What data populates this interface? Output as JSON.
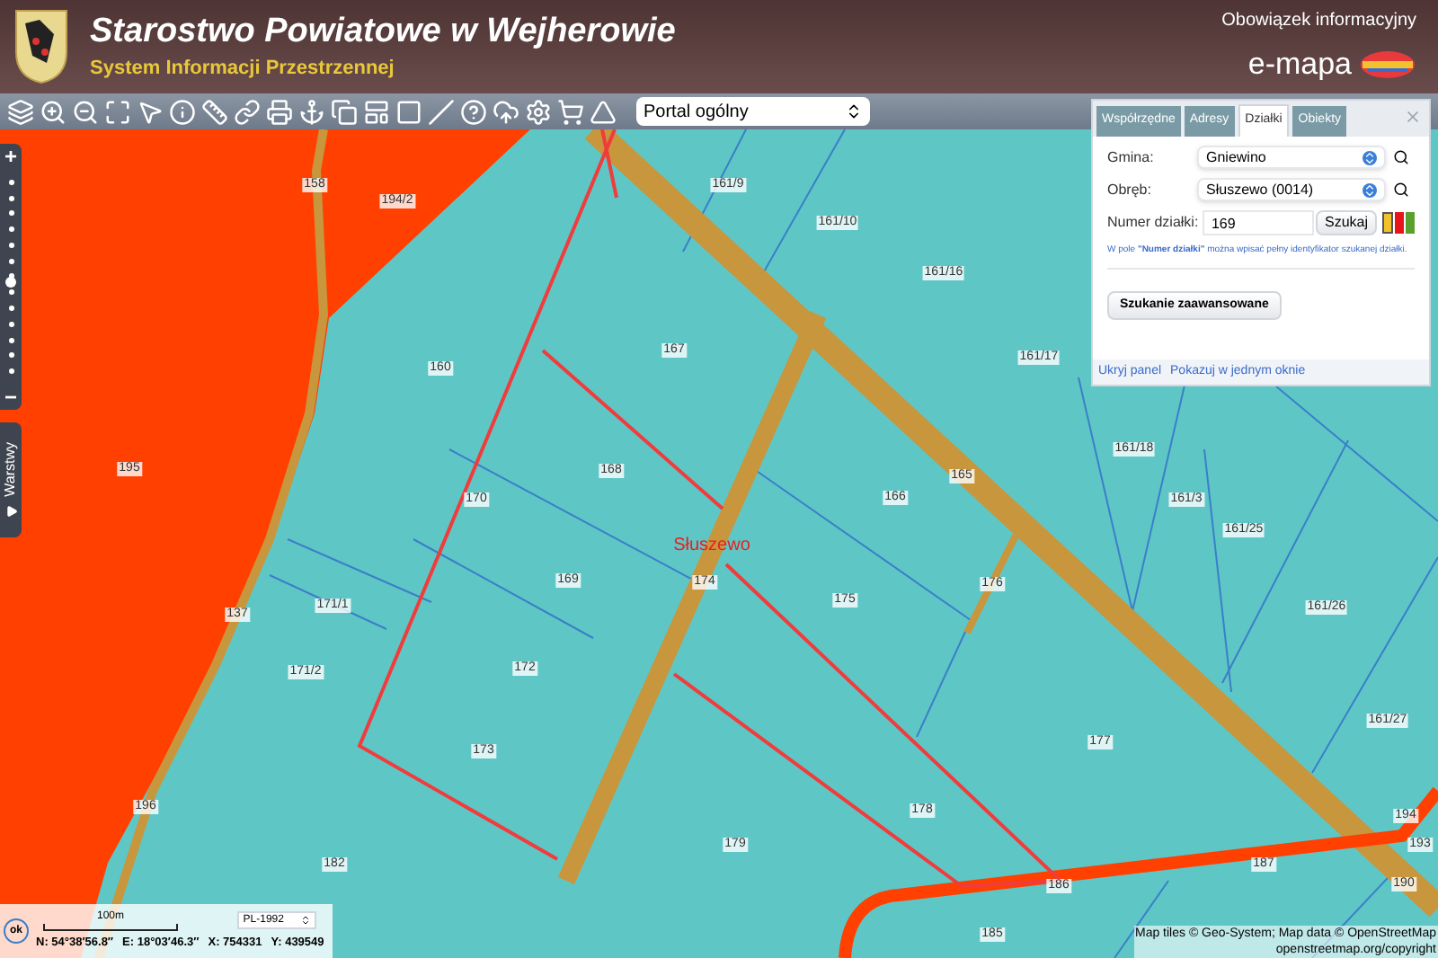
{
  "header": {
    "title": "Starostwo Powiatowe w Wejherowie",
    "subtitle": "System Informacji Przestrzennej",
    "info_link": "Obowiązek informacyjny",
    "brand": "e-mapa"
  },
  "toolbar": {
    "portal_select": "Portal ogólny"
  },
  "zoom_bar": {
    "plus": "+",
    "minus": "−",
    "level": 0.5
  },
  "layers_tab": {
    "label": "Warstwy"
  },
  "search_panel": {
    "tabs": [
      {
        "label": "Współrzędne",
        "selected": false
      },
      {
        "label": "Adresy",
        "selected": false
      },
      {
        "label": "Działki",
        "selected": true
      },
      {
        "label": "Obiekty",
        "selected": false
      }
    ],
    "fields": [
      {
        "label": "Gmina:",
        "value": "Gniewino"
      },
      {
        "label": "Obręb:",
        "value": "Słuszewo (0014)"
      }
    ],
    "parcel_number": {
      "label": "Numer działki:",
      "value": "169"
    },
    "search_button": "Szukaj",
    "swatches": [
      {
        "color": "#f2c12e",
        "selected": true
      },
      {
        "color": "#e8141c",
        "selected": false
      },
      {
        "color": "#5aa02c",
        "selected": false
      }
    ],
    "hint": "W pole **\"Numer działki\"** można wpisać pełny identyfikator szukanej działki.",
    "advanced_button": "Szukanie zaawansowane",
    "links": [
      "Ukryj panel",
      "Pokazuj w jednym oknie"
    ]
  },
  "map": {
    "place_name": "Słuszewo",
    "parcel_labels": [
      "158",
      "194/2",
      "161/9",
      "161/10",
      "161/16",
      "161/17",
      "160",
      "167",
      "195",
      "168",
      "166",
      "165",
      "161/18",
      "161/3",
      "161/25",
      "161/26",
      "170",
      "169",
      "174",
      "175",
      "176",
      "171/1",
      "171/2",
      "137",
      "172",
      "173",
      "177",
      "161/27",
      "178",
      "179",
      "196",
      "182",
      "186",
      "187",
      "185",
      "194",
      "193",
      "190"
    ]
  },
  "coordinates": {
    "ok_button": "ok",
    "scale": "100m",
    "system": "PL-1992",
    "readouts": [
      "N: 54°38′56.8″",
      "E: 18°03′46.3″",
      "X: 754331",
      "Y: 439549"
    ]
  },
  "attribution": [
    "Map tiles © Geo-System; Map data © OpenStreetMap",
    "openstreetmap.org/copyright"
  ]
}
